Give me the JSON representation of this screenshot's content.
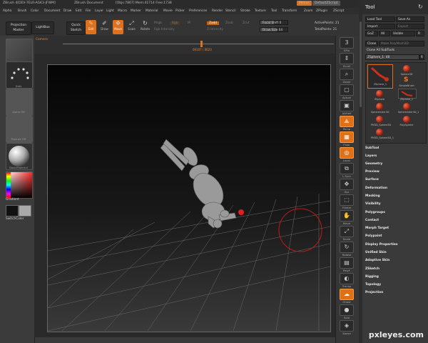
{
  "titlebar": {
    "app": "ZBrush 4[DEV-7ELR-AGK3-JFWM]",
    "doc": "ZBrush Document",
    "stats": "[Objs:7867]  Mem:41714  Free:1738",
    "menus_button": "Menus",
    "script_button": "DefaultZScript"
  },
  "menubar": [
    "Alpha",
    "Brush",
    "Color",
    "Document",
    "Draw",
    "Edit",
    "File",
    "Layer",
    "Light",
    "Macro",
    "Marker",
    "Material",
    "Movie",
    "Picker",
    "Preferences",
    "Render",
    "Stencil",
    "Stroke",
    "Texture",
    "Tool",
    "Transform",
    "Zoom",
    "ZPlugin",
    "ZScript"
  ],
  "toolbar": {
    "projection_master": "Projection Master",
    "lightbox": "LightBox",
    "quick_sketch": "Quick Sketch",
    "edit": "Edit",
    "draw": "Draw",
    "move": "Move",
    "scale": "Scale",
    "rotate": "Rotate",
    "mrgb": "Mrgb",
    "rgb": "Rgb",
    "m": "M",
    "zadd": "Zadd",
    "zsub": "Zsub",
    "zcut": "Zcut",
    "rgb_intensity": "Rgb Intensity",
    "z_intensity": "Z Intensity",
    "focal_shift_label": "Focal Shift",
    "focal_shift_value": "0",
    "draw_size_label": "Draw Size",
    "draw_size_value": "64",
    "active_points": "ActivePoints: 21",
    "total_points": "TotalPoints: 21"
  },
  "left_tray": {
    "brush_label": "Dots",
    "alpha_label": "Alpha Off",
    "texture_label": "Texture Off",
    "material_label": "BasicMaterial",
    "gradient_label": "Gradient",
    "switch_color": "SwitchColor"
  },
  "timeline": {
    "label": "Camera",
    "readout": "00107 / 0623"
  },
  "shelf": [
    {
      "icon": "spix-icon",
      "label": "SPix",
      "text": "3"
    },
    {
      "icon": "scroll-icon",
      "label": "Scroll",
      "text": "⇕"
    },
    {
      "icon": "zoom-icon",
      "label": "Zoom",
      "text": "⌕"
    },
    {
      "icon": "actual-icon",
      "label": "Actual",
      "text": "▢"
    },
    {
      "icon": "aahalf-icon",
      "label": "AAHalf",
      "text": "▣"
    },
    {
      "icon": "persp-icon",
      "label": "Persp",
      "text": "⟁"
    },
    {
      "icon": "floor-icon",
      "label": "Floor",
      "text": "▦"
    },
    {
      "icon": "local-icon",
      "label": "Local",
      "text": "◎"
    },
    {
      "icon": "lsym-icon",
      "label": "L.Sym",
      "text": "⧉"
    },
    {
      "icon": "xyz-icon",
      "label": "Xyz",
      "text": "✥"
    },
    {
      "icon": "frame-icon",
      "label": "Frame",
      "text": "⬚"
    },
    {
      "icon": "move-icon",
      "label": "Move",
      "text": "✋"
    },
    {
      "icon": "scale-icon",
      "label": "Scale",
      "text": "⤢"
    },
    {
      "icon": "rotate-icon",
      "label": "Rotate",
      "text": "↻"
    },
    {
      "icon": "polyf-icon",
      "label": "PolyF",
      "text": "▤"
    },
    {
      "icon": "transp-icon",
      "label": "Transp",
      "text": "◐"
    },
    {
      "icon": "ghost-icon",
      "label": "Ghost",
      "text": "☁"
    },
    {
      "icon": "solo-icon",
      "label": "Solo",
      "text": "●"
    },
    {
      "icon": "xpose-icon",
      "label": "Xpose",
      "text": "◈"
    }
  ],
  "tool": {
    "title": "Tool",
    "load_tool": "Load Tool",
    "save_as": "Save As",
    "import": "Import",
    "export": "Export",
    "goz": "GoZ",
    "all": "All",
    "visible": "Visible",
    "r": "R",
    "clone": "Clone",
    "make_polymesh": "Make PolyMesh3D",
    "clone_all_subtools": "Clone All SubTools",
    "current_tool": "ZSphere_1: 48",
    "tools": [
      {
        "name": "ZSphere_1",
        "kind": "thumb"
      },
      {
        "name": "Sphere3D"
      },
      {
        "name": "SimpleBrush"
      },
      {
        "name": "ZSphere"
      },
      {
        "name": "ZSphere_1"
      },
      {
        "name": "Sphereinder3D"
      },
      {
        "name": "Sphereinder3D_1"
      },
      {
        "name": "PM3D_Sphere3D"
      },
      {
        "name": "PolySphere"
      },
      {
        "name": "PM3D_Sphere3D_1"
      }
    ],
    "sections": [
      "SubTool",
      "Layers",
      "Geometry",
      "Preview",
      "Surface",
      "Deformation",
      "Masking",
      "Visibility",
      "Polygroups",
      "Contact",
      "Morph Target",
      "Polypaint",
      "Display Properties",
      "Unified Skin",
      "Adaptive Skin",
      "ZSketch",
      "Rigging",
      "Topology",
      "Projection"
    ]
  },
  "colors": {
    "accent": "#e0701a",
    "panel": "#3a3a3a",
    "canvas": "#111111"
  },
  "watermark": "pxleyes.com"
}
